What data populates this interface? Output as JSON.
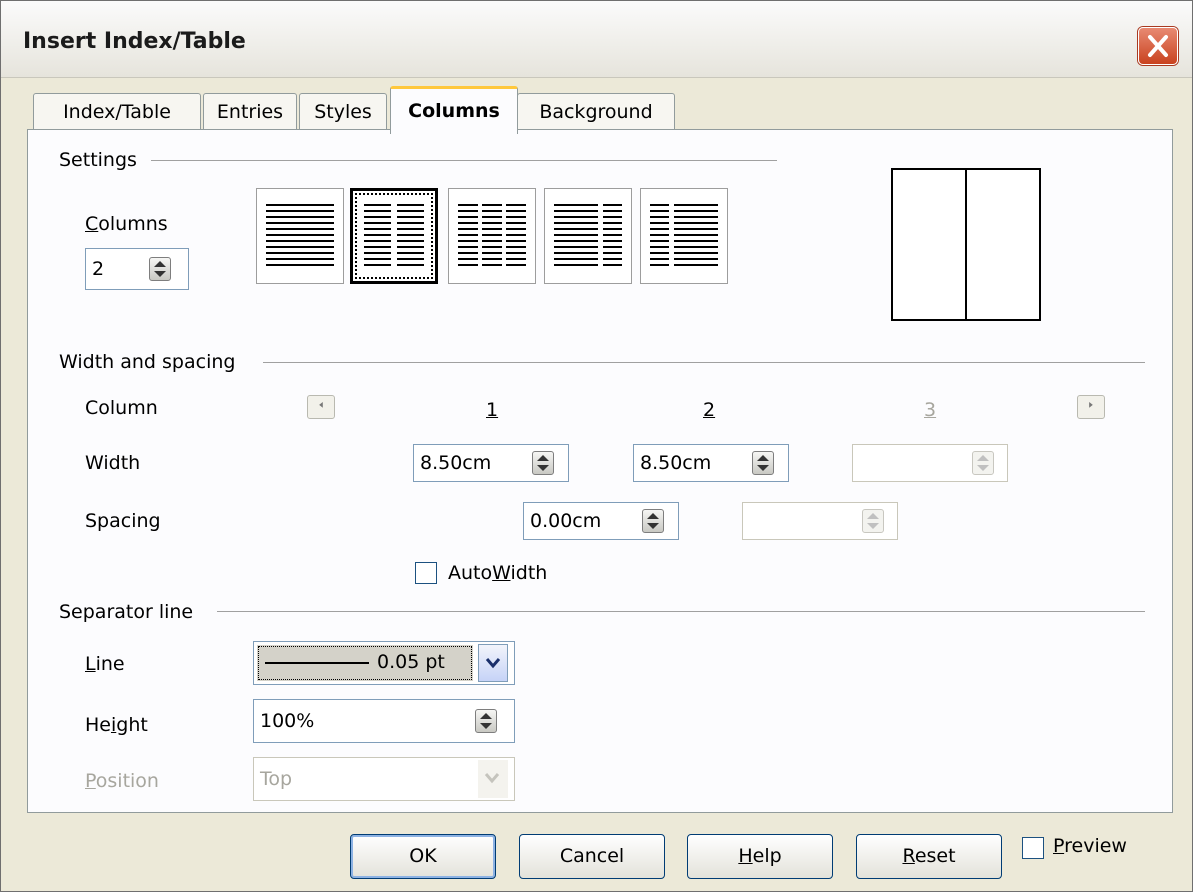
{
  "window": {
    "title": "Insert Index/Table"
  },
  "tabs": [
    {
      "label": "Index/Table"
    },
    {
      "label": "Entries"
    },
    {
      "label": "Styles"
    },
    {
      "label": "Columns",
      "active": true
    },
    {
      "label": "Background"
    }
  ],
  "settings": {
    "section_label": "Settings",
    "columns_label_first": "C",
    "columns_label_rest": "olumns",
    "columns_value": "2",
    "layouts": [
      "one-column",
      "two-columns",
      "three-columns",
      "two-columns-left-wide",
      "two-columns-right-wide"
    ],
    "selected_layout": "two-columns"
  },
  "width_spacing": {
    "section_label": "Width and spacing",
    "column_label": "Column",
    "width_label": "Width",
    "spacing_label": "Spacing",
    "col_numbers": [
      "1",
      "2",
      "3"
    ],
    "widths": [
      "8.50cm",
      "8.50cm",
      ""
    ],
    "spacings": [
      "0.00cm",
      ""
    ],
    "autowidth_pre": "Auto",
    "autowidth_u": "W",
    "autowidth_post": "idth",
    "autowidth_checked": false
  },
  "separator": {
    "section_label": "Separator line",
    "line_label_u": "L",
    "line_label_rest": "ine",
    "line_value": "0.05 pt",
    "height_label_pre": "He",
    "height_label_u": "i",
    "height_label_post": "ght",
    "height_value": "100%",
    "position_label_u": "P",
    "position_label_rest": "osition",
    "position_value": "Top"
  },
  "buttons": {
    "ok": "OK",
    "cancel": "Cancel",
    "help_u": "H",
    "help_rest": "elp",
    "reset_u": "R",
    "reset_rest": "eset",
    "preview_u": "P",
    "preview_rest": "review",
    "preview_checked": false
  }
}
